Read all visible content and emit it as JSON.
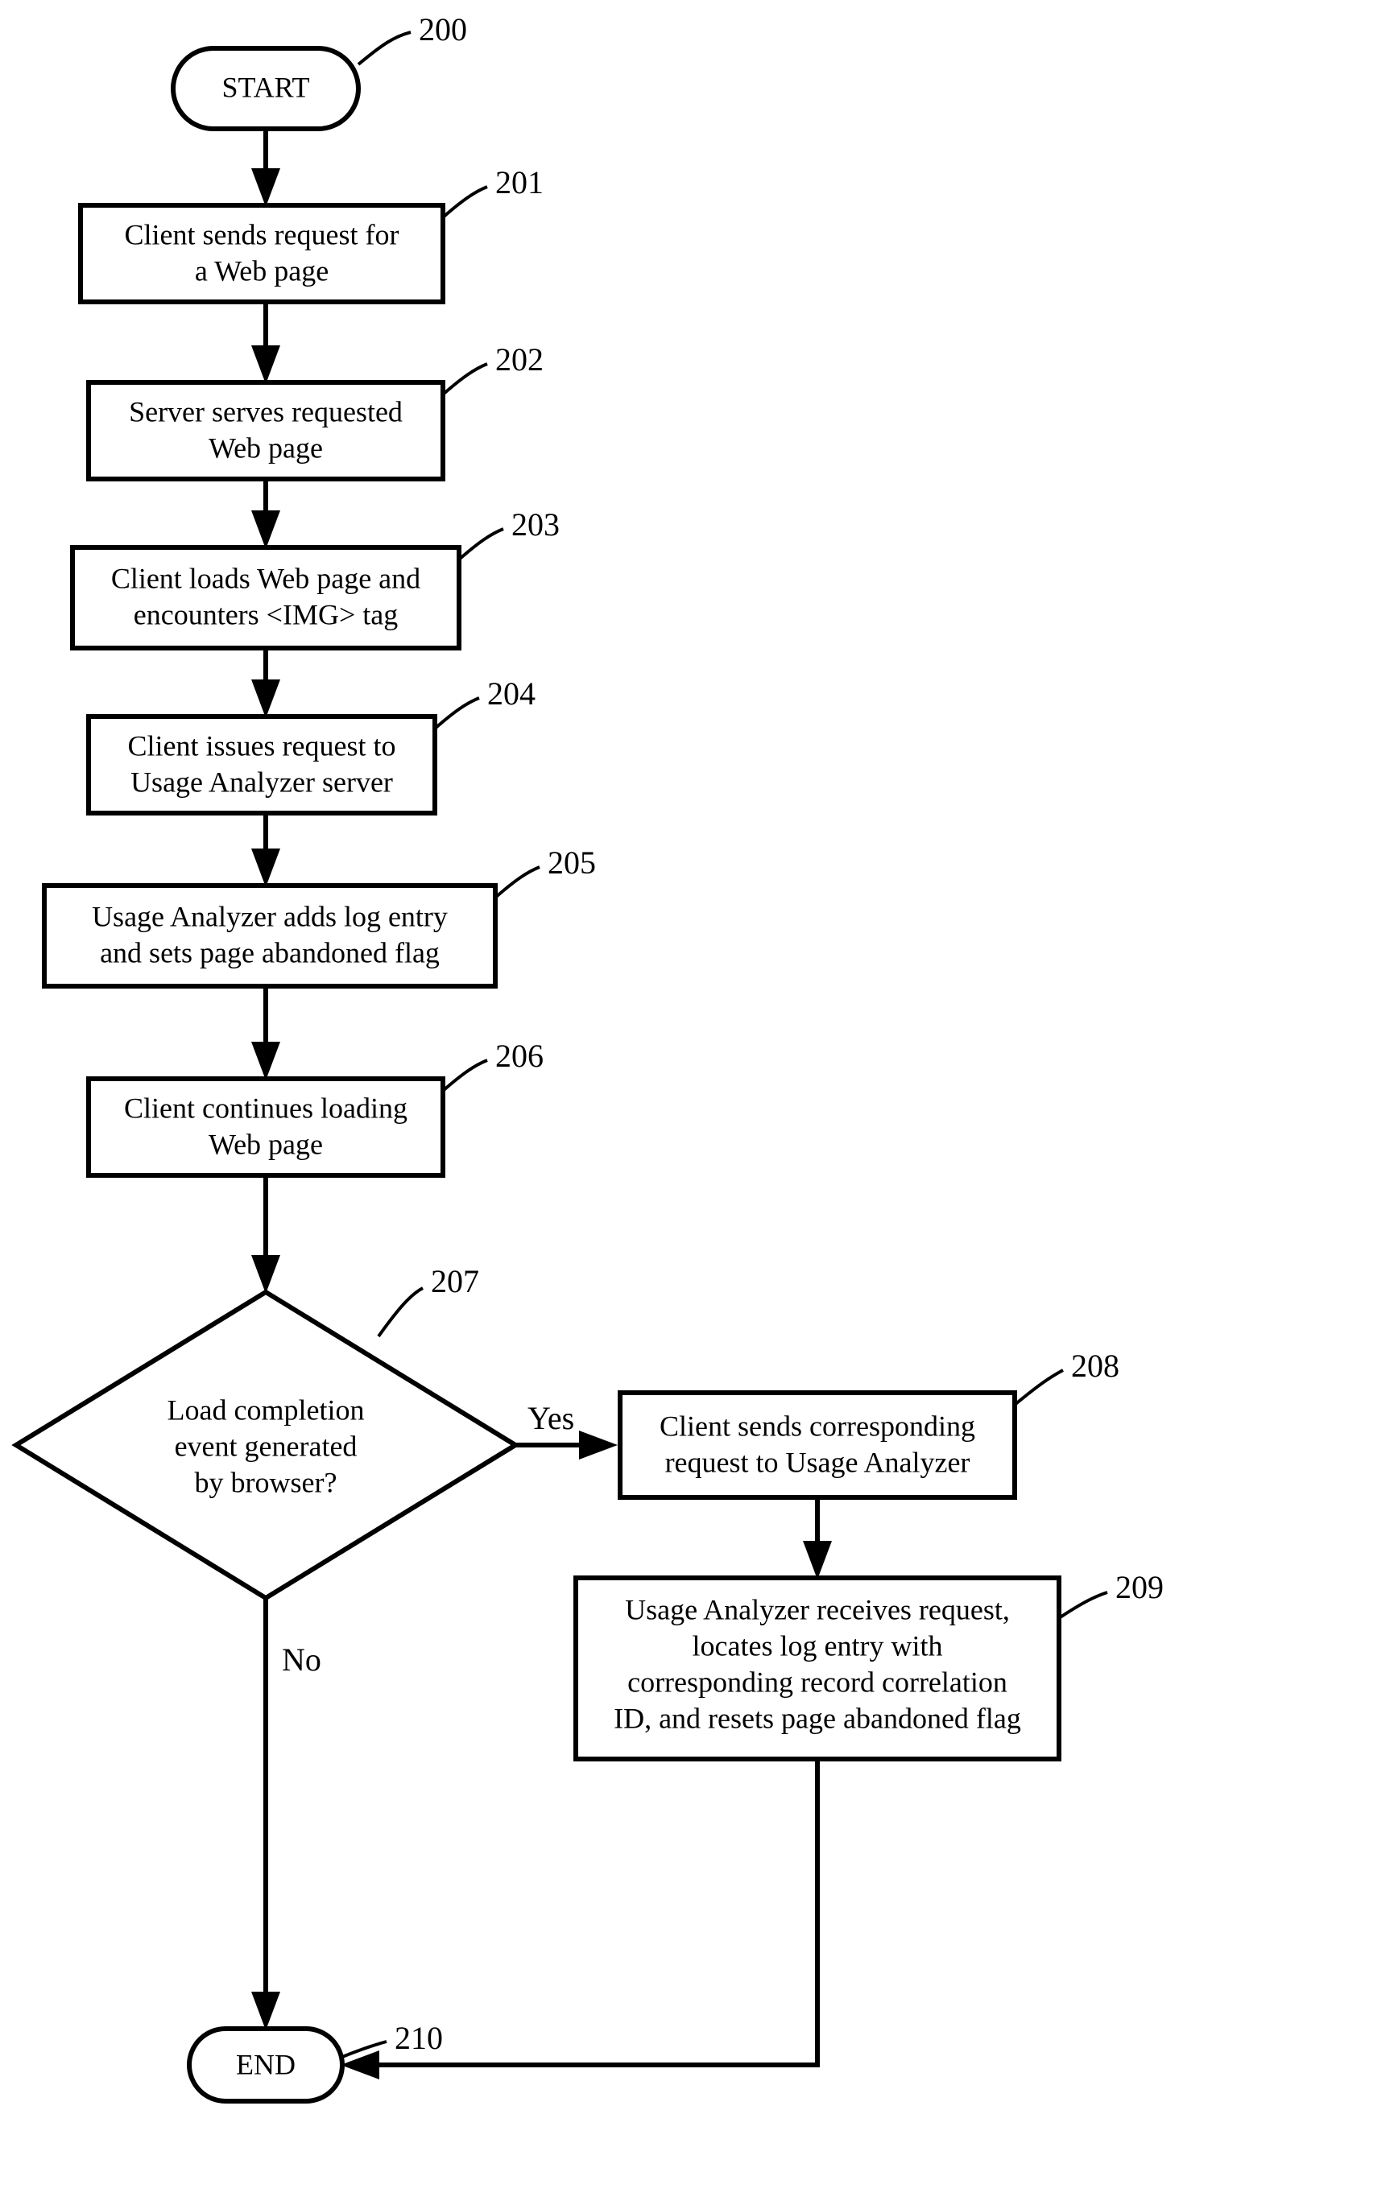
{
  "nodes": {
    "start": {
      "label": "START",
      "ref": "200"
    },
    "n201": {
      "line1": "Client sends request for",
      "line2": "a Web page",
      "ref": "201"
    },
    "n202": {
      "line1": "Server serves requested",
      "line2": "Web page",
      "ref": "202"
    },
    "n203": {
      "line1": "Client loads Web page and",
      "line2": "encounters <IMG> tag",
      "ref": "203"
    },
    "n204": {
      "line1": "Client issues request to",
      "line2": "Usage Analyzer server",
      "ref": "204"
    },
    "n205": {
      "line1": "Usage Analyzer adds log entry",
      "line2": "and sets page abandoned flag",
      "ref": "205"
    },
    "n206": {
      "line1": "Client continues loading",
      "line2": "Web page",
      "ref": "206"
    },
    "n207": {
      "line1": "Load completion",
      "line2": "event generated",
      "line3": "by browser?",
      "ref": "207",
      "yes": "Yes",
      "no": "No"
    },
    "n208": {
      "line1": "Client sends corresponding",
      "line2": "request to Usage Analyzer",
      "ref": "208"
    },
    "n209": {
      "line1": "Usage Analyzer receives request,",
      "line2": "locates log entry with",
      "line3": "corresponding record correlation",
      "line4": "ID, and resets page abandoned flag",
      "ref": "209"
    },
    "end": {
      "label": "END",
      "ref": "210"
    }
  }
}
